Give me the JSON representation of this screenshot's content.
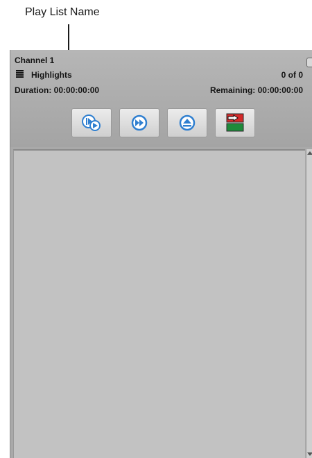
{
  "callout": {
    "label": "Play List Name"
  },
  "header": {
    "channel": "Channel 1",
    "playlist_name": "Highlights",
    "count": "0 of 0",
    "duration": "Duration: 00:00:00:00",
    "remaining": "Remaining: 00:00:00:00"
  },
  "controls": [
    {
      "name": "play-clip-button",
      "icon": "play-clip-icon"
    },
    {
      "name": "fast-forward-button",
      "icon": "fast-forward-icon"
    },
    {
      "name": "eject-button",
      "icon": "eject-icon"
    },
    {
      "name": "output-toggle-button",
      "icon": "output-toggle-icon"
    }
  ],
  "colors": {
    "accent_blue": "#2f7fd0",
    "active_red": "#d42a2a",
    "active_green": "#1e8a3a"
  }
}
